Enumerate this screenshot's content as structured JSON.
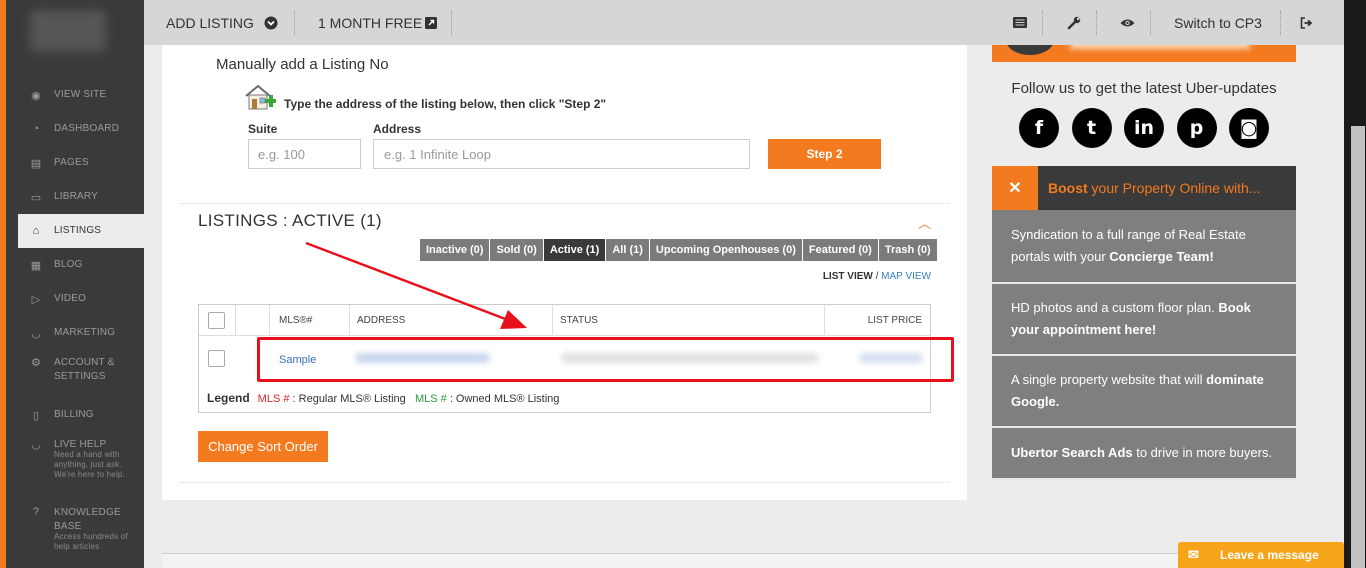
{
  "sidebar": {
    "items": [
      {
        "label": "VIEW SITE",
        "icon": "eye-icon",
        "glyph": "◉"
      },
      {
        "label": "DASHBOARD",
        "icon": "dashboard-icon",
        "glyph": "◔"
      },
      {
        "label": "PAGES",
        "icon": "pages-icon",
        "glyph": "▤"
      },
      {
        "label": "LIBRARY",
        "icon": "library-icon",
        "glyph": "▭"
      },
      {
        "label": "LISTINGS",
        "icon": "home-icon",
        "glyph": "⌂"
      },
      {
        "label": "BLOG",
        "icon": "blog-icon",
        "glyph": "▦"
      },
      {
        "label": "VIDEO",
        "icon": "video-icon",
        "glyph": "▷"
      },
      {
        "label": "MARKETING",
        "icon": "marketing-icon",
        "glyph": "◡"
      },
      {
        "label": "ACCOUNT & SETTINGS",
        "icon": "settings-icon",
        "glyph": "⚙"
      },
      {
        "label": "BILLING",
        "icon": "billing-icon",
        "glyph": "▯"
      },
      {
        "label": "LIVE HELP",
        "icon": "chat-icon",
        "glyph": "◡",
        "sub": "Need a hand with anything, just ask. We're here to help."
      },
      {
        "label": "KNOWLEDGE BASE",
        "icon": "question-icon",
        "glyph": "?",
        "sub": "Access hundreds of help articles"
      }
    ]
  },
  "topbar": {
    "add_listing": "ADD LISTING",
    "month_free": "1 MONTH FREE",
    "switch_cp3": "Switch to CP3"
  },
  "manual": {
    "title": "Manually add a Listing No",
    "instruction": "Type the address of the listing below, then click \"Step 2\"",
    "suite_label": "Suite",
    "address_label": "Address",
    "suite_placeholder": "e.g. 100",
    "address_placeholder": "e.g. 1 Infinite Loop",
    "step2_label": "Step 2"
  },
  "listings": {
    "title": "LISTINGS : ACTIVE (1)",
    "filters": [
      {
        "label": "Inactive (0)",
        "active": false
      },
      {
        "label": "Sold (0)",
        "active": false
      },
      {
        "label": "Active (1)",
        "active": true
      },
      {
        "label": "All (1)",
        "active": false
      },
      {
        "label": "Upcoming Openhouses (0)",
        "active": false
      },
      {
        "label": "Featured (0)",
        "active": false
      },
      {
        "label": "Trash (0)",
        "active": false
      }
    ],
    "list_view": "LIST VIEW",
    "view_sep": " / ",
    "map_view": "MAP VIEW",
    "columns": {
      "mls": "MLS®#",
      "address": "ADDRESS",
      "status": "STATUS",
      "price": "LIST PRICE"
    },
    "rows": [
      {
        "mls": "Sample"
      }
    ],
    "legend": {
      "title": "Legend",
      "regular_key": "MLS #",
      "regular_text": " : Regular MLS® Listing",
      "owned_key": "MLS #",
      "owned_text": " : Owned MLS® Listing"
    },
    "sort_label": "Change Sort Order"
  },
  "right": {
    "follow": "Follow us to get the latest Uber-updates",
    "socials": [
      {
        "icon": "facebook-icon",
        "glyph": "f"
      },
      {
        "icon": "twitter-icon",
        "glyph": "t"
      },
      {
        "icon": "linkedin-icon",
        "glyph": "in"
      },
      {
        "icon": "pinterest-icon",
        "glyph": "p"
      },
      {
        "icon": "instagram-icon",
        "glyph": "◙"
      }
    ],
    "boost_bold": "Boost",
    "boost_rest": " your Property Online with...",
    "boost_items": [
      {
        "pre": "Syndication to a full range of Real Estate portals with your ",
        "bold": "Concierge Team!",
        "post": ""
      },
      {
        "pre": "HD photos and a custom floor plan. ",
        "bold": "Book your appointment here!",
        "post": ""
      },
      {
        "pre": "A single property website that will ",
        "bold": "dominate Google.",
        "post": ""
      },
      {
        "pre": "",
        "bold": "Ubertor Search Ads",
        "post": " to drive in more buyers."
      }
    ]
  },
  "chat": {
    "label": "Leave a message"
  },
  "colors": {
    "accent": "#f47a20",
    "sidebar": "#3a3a3a",
    "highlight": "#e8101a"
  }
}
